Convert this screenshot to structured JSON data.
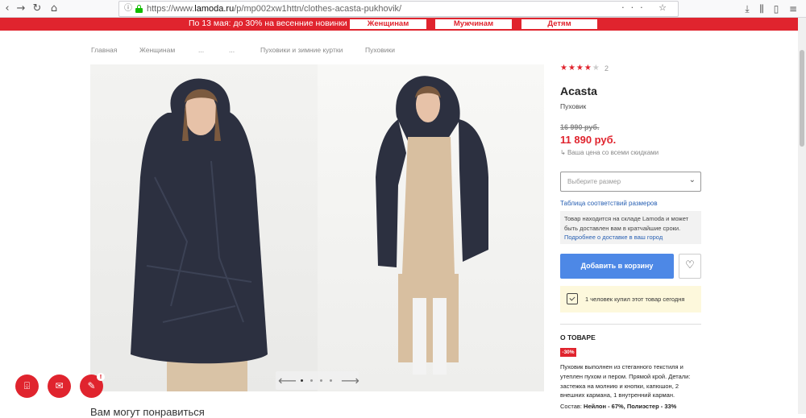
{
  "browser": {
    "url_prefix": "https://www.",
    "url_host": "lamoda.ru",
    "url_path": "/p/mp002xw1httn/clothes-acasta-pukhovik/",
    "url_actions": "··· ☆"
  },
  "promo": {
    "text": "По 13 мая: до 30% на весенние новинки",
    "buttons": [
      "Женщинам",
      "Мужчинам",
      "Детям"
    ]
  },
  "breadcrumb": [
    "Главная",
    "Женщинам",
    "...",
    "...",
    "Пуховики и зимние куртки",
    "Пуховики"
  ],
  "product": {
    "rating_stars_filled": "★★★★",
    "rating_stars_empty": "★",
    "rating_count": "2",
    "brand": "Acasta",
    "type": "Пуховик",
    "old_price": "16 990 руб.",
    "new_price": "11 890 руб.",
    "price_note": "Ваша цена со всеми скидками",
    "size_placeholder": "Выберите размер",
    "size_table_link": "Таблица соответствий размеров",
    "stock_text": "Товар находится на складе Lamoda и может быть доставлен вам в кратчайшие сроки.",
    "delivery_link": "Подробнее о доставке в ваш город",
    "add_to_cart": "Добавить в корзину",
    "bought_text": "1 человек купил этот товар сегодня",
    "about_title": "О ТОВАРЕ",
    "discount": "-30%",
    "description": "Пуховик выполнен из стеганного текстиля и утеплен пухом и пером. Прямой крой. Детали: застежка на молнию и кнопки, капюшон, 2 внешних кармана, 1 внутренний карман.",
    "composition_label": "Состав:",
    "composition_value": "Нейлон - 67%, Полиэстер - 33%"
  },
  "gallery": {
    "slide_count": 5,
    "active_slide": 1
  },
  "section_title": "Вам могут понравиться",
  "colors": {
    "brand_red": "#e0242e",
    "cart_blue": "#4d88e6",
    "link_blue": "#2860b3"
  }
}
